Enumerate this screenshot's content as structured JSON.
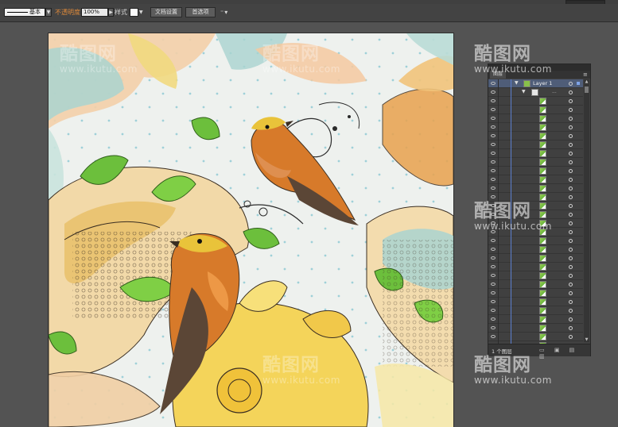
{
  "control_bar": {
    "stroke_style_label": "基本",
    "opacity_label": "不透明度",
    "opacity_value": "100%",
    "style_label": "样式",
    "document_setup_button": "文档设置",
    "preferences_button": "首选项",
    "arrange_icon": "arrange-documents-icon"
  },
  "layers_panel": {
    "tab_label": "图层",
    "layer_name": "Layer 1",
    "sub_layer_name": "...",
    "footer_count": "1 个图层",
    "item_count": 31
  },
  "watermarks": [
    {
      "logo": "酷图网",
      "url": "www.ikutu.com"
    },
    {
      "logo": "酷图网",
      "url": "www.ikutu.com"
    },
    {
      "logo": "酷图网",
      "url": "www.ikutu.com"
    },
    {
      "logo": "酷图网",
      "url": "www.ikutu.com"
    },
    {
      "logo": "酷图网",
      "url": "www.ikutu.com"
    },
    {
      "logo": "酷图网",
      "url": "www.ikutu.com"
    }
  ],
  "colors": {
    "workspace_bg": "#535353",
    "accent_orange": "#e08a3a",
    "panel_selected": "#4f5d78"
  }
}
